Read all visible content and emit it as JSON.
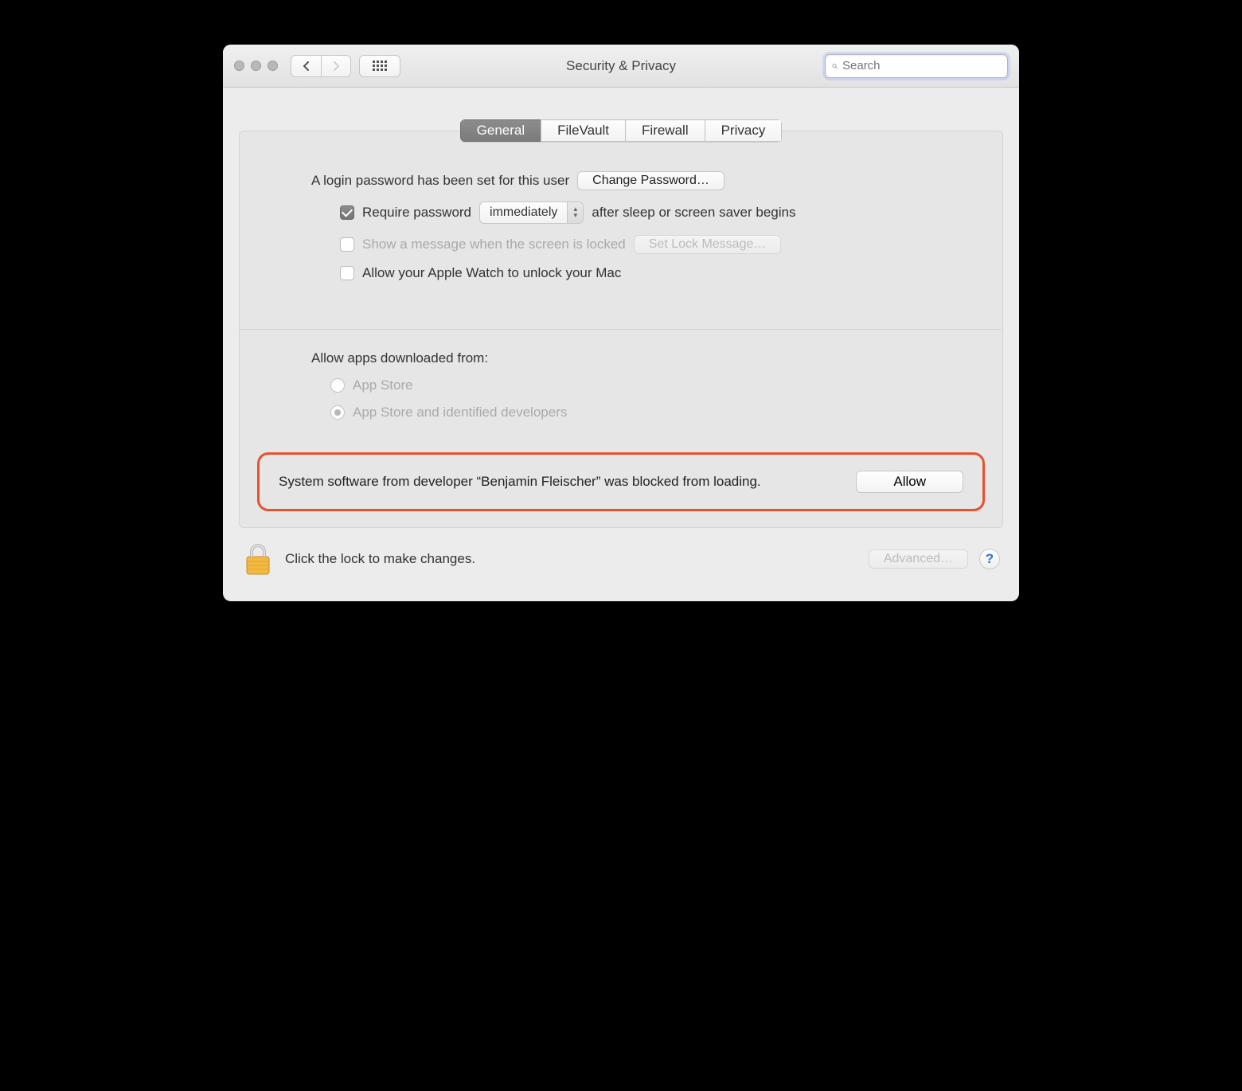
{
  "title": "Security & Privacy",
  "search": {
    "placeholder": "Search"
  },
  "tabs": [
    "General",
    "FileVault",
    "Firewall",
    "Privacy"
  ],
  "login": {
    "text": "A login password has been set for this user",
    "change_btn": "Change Password…"
  },
  "require_pw": {
    "prefix": "Require password",
    "select": "immediately",
    "suffix": "after sleep or screen saver begins"
  },
  "lock_msg": {
    "label": "Show a message when the screen is locked",
    "btn": "Set Lock Message…"
  },
  "watch": {
    "label": "Allow your Apple Watch to unlock your Mac"
  },
  "apps": {
    "label": "Allow apps downloaded from:",
    "opt1": "App Store",
    "opt2": "App Store and identified developers"
  },
  "blocked": {
    "text": "System software from developer “Benjamin Fleischer” was blocked from loading.",
    "btn": "Allow"
  },
  "footer": {
    "text": "Click the lock to make changes.",
    "advanced": "Advanced…",
    "help": "?"
  }
}
